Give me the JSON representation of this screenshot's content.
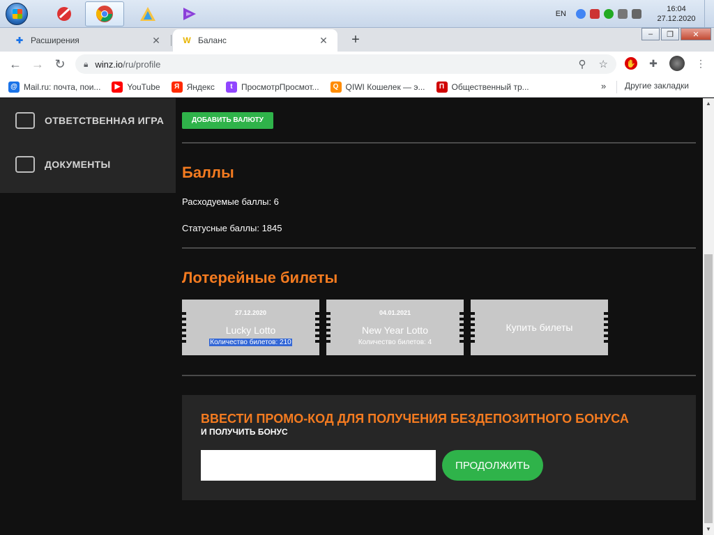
{
  "taskbar": {
    "lang": "EN",
    "time": "16:04",
    "date": "27.12.2020",
    "apps": [
      "ccleaner",
      "chrome",
      "app-triangle",
      "visual-studio"
    ]
  },
  "browser": {
    "tabs": [
      {
        "title": "Расширения",
        "active": false
      },
      {
        "title": "Баланс",
        "active": true
      }
    ],
    "url_domain": "winz.io",
    "url_path": "/ru/profile",
    "bookmarks": [
      {
        "label": "Mail.ru: почта, пои...",
        "color": "#1a73e8",
        "glyph": "@"
      },
      {
        "label": "YouTube",
        "color": "#ff0000",
        "glyph": "▶"
      },
      {
        "label": "Яндекс",
        "color": "#ff2a00",
        "glyph": "Я"
      },
      {
        "label": "ПросмотрПросмот...",
        "color": "#9146ff",
        "glyph": "t"
      },
      {
        "label": "QIWI Кошелек — э...",
        "color": "#ff8c00",
        "glyph": "Q"
      },
      {
        "label": "Общественный тр...",
        "color": "#d00000",
        "glyph": "П"
      }
    ],
    "more": "»",
    "other_bookmarks": "Другие закладки"
  },
  "sidebar": {
    "items": [
      {
        "label": "ОТВЕТСТВЕННАЯ ИГРА"
      },
      {
        "label": "ДОКУМЕНТЫ"
      }
    ]
  },
  "balance": {
    "add_currency_label": "ДОБАВИТЬ ВАЛЮТУ"
  },
  "points": {
    "heading": "Баллы",
    "spendable": "Расходуемые баллы: 6",
    "status": "Статусные баллы: 1845"
  },
  "lottery": {
    "heading": "Лотерейные билеты",
    "tickets": [
      {
        "date": "27.12.2020",
        "name": "Lucky Lotto",
        "count": "Количество билетов: 210"
      },
      {
        "date": "04.01.2021",
        "name": "New Year Lotto",
        "count": "Количество билетов: 4"
      }
    ],
    "buy_label": "Купить билеты"
  },
  "promo": {
    "title": "ВВЕСТИ ПРОМО-КОД ДЛЯ ПОЛУЧЕНИЯ БЕЗДЕПОЗИТНОГО БОНУСА",
    "subtitle": "И ПОЛУЧИТЬ БОНУС",
    "input_value": "",
    "button_label": "ПРОДОЛЖИТЬ"
  },
  "colors": {
    "accent": "#f47b20",
    "green": "#2fb34a",
    "page_bg": "#111111",
    "panel_bg": "#262626",
    "ticket": "#c8c8c8"
  }
}
